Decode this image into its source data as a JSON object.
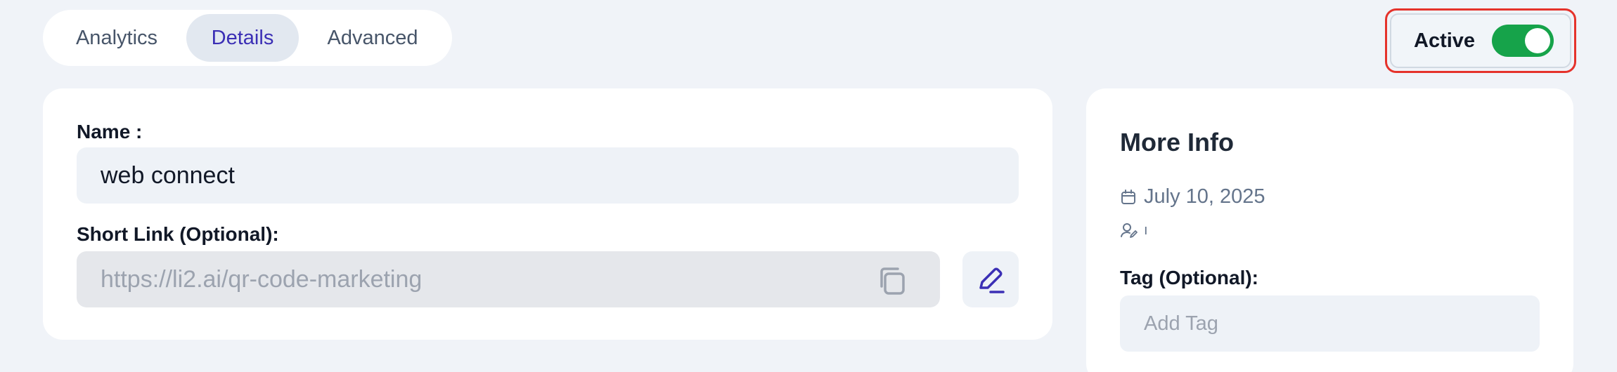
{
  "tabs": [
    {
      "label": "Analytics"
    },
    {
      "label": "Details",
      "selected": true
    },
    {
      "label": "Advanced"
    }
  ],
  "status": {
    "label": "Active",
    "toggle_on": true,
    "toggle_color": "#16a34a",
    "highlight_color": "#e5322b"
  },
  "details": {
    "name_label": "Name :",
    "name_value": "web connect",
    "short_link_label": "Short Link (Optional):",
    "short_link_value": "https://li2.ai/qr-code-marketing"
  },
  "more_info": {
    "title": "More Info",
    "date": "July 10, 2025",
    "user": "ı",
    "tag_label": "Tag (Optional):",
    "tag_placeholder": "Add Tag"
  },
  "icons": [
    "calendar-icon",
    "user-edit-icon",
    "copy-icon",
    "pencil-icon"
  ],
  "colors": {
    "accent": "#3b2fb5",
    "background": "#f0f3f8"
  }
}
